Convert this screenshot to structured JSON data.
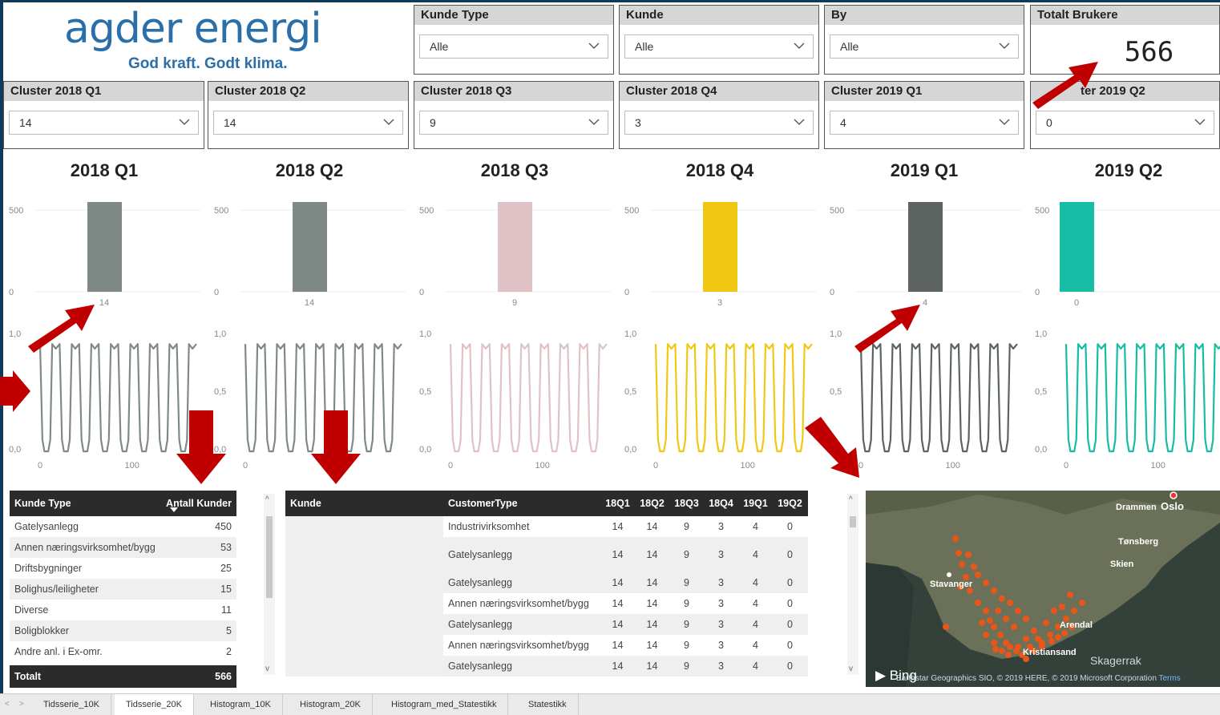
{
  "logo": {
    "brand": "agder energi",
    "tagline": "God kraft. Godt klima."
  },
  "filters": [
    {
      "label": "Kunde Type",
      "value": "Alle"
    },
    {
      "label": "Kunde",
      "value": "Alle"
    },
    {
      "label": "By",
      "value": "Alle"
    }
  ],
  "kpi": {
    "label": "Totalt Brukere",
    "value": "566"
  },
  "cluster_slicers": [
    {
      "label": "Cluster 2018 Q1",
      "value": "14"
    },
    {
      "label": "Cluster 2018 Q2",
      "value": "14"
    },
    {
      "label": "Cluster 2018 Q3",
      "value": "9"
    },
    {
      "label": "Cluster 2018 Q4",
      "value": "3"
    },
    {
      "label": "Cluster 2019 Q1",
      "value": "4"
    },
    {
      "label": "ter 2019 Q2",
      "value": "0"
    }
  ],
  "quarters": [
    {
      "title": "2018 Q1",
      "color": "#7f8a87"
    },
    {
      "title": "2018 Q2",
      "color": "#7f8a87"
    },
    {
      "title": "2018 Q3",
      "color": "#e0c2c6"
    },
    {
      "title": "2018 Q4",
      "color": "#f0c814"
    },
    {
      "title": "2019 Q1",
      "color": "#5c6361"
    },
    {
      "title": "2019 Q2",
      "color": "#16bca4"
    }
  ],
  "chart_data": [
    {
      "type": "bar",
      "title": "2018 Q1",
      "categories": [
        "14"
      ],
      "values": [
        550
      ],
      "ylim": [
        0,
        550
      ],
      "yticks": [
        "500",
        "0"
      ]
    },
    {
      "type": "bar",
      "title": "2018 Q2",
      "categories": [
        "14"
      ],
      "values": [
        550
      ],
      "ylim": [
        0,
        550
      ],
      "yticks": [
        "500",
        "0"
      ]
    },
    {
      "type": "bar",
      "title": "2018 Q3",
      "categories": [
        "9"
      ],
      "values": [
        550
      ],
      "ylim": [
        0,
        550
      ],
      "yticks": [
        "500",
        "0"
      ]
    },
    {
      "type": "bar",
      "title": "2018 Q4",
      "categories": [
        "3"
      ],
      "values": [
        550
      ],
      "ylim": [
        0,
        550
      ],
      "yticks": [
        "500",
        "0"
      ]
    },
    {
      "type": "bar",
      "title": "2019 Q1",
      "categories": [
        "4"
      ],
      "values": [
        550
      ],
      "ylim": [
        0,
        550
      ],
      "yticks": [
        "500",
        "0"
      ]
    },
    {
      "type": "bar",
      "title": "2019 Q2",
      "categories": [
        "0"
      ],
      "values": [
        550
      ],
      "ylim": [
        0,
        550
      ],
      "yticks": [
        "500",
        "0"
      ]
    },
    {
      "type": "line",
      "yticks": [
        "1,0",
        "0,5",
        "0,0"
      ],
      "xticks": [
        "0",
        "100"
      ],
      "xlim": [
        0,
        170
      ],
      "ylim": [
        0,
        1
      ],
      "cycles": 8,
      "top_value": 0.95,
      "bottom_value": 0.02
    }
  ],
  "kunde_type_table": {
    "headers": [
      "Kunde Type",
      "Antall Kunder"
    ],
    "rows": [
      [
        "Gatelysanlegg",
        "450"
      ],
      [
        "Annen næringsvirksomhet/bygg",
        "53"
      ],
      [
        "Driftsbygninger",
        "25"
      ],
      [
        "Bolighus/leiligheter",
        "15"
      ],
      [
        "Diverse",
        "11"
      ],
      [
        "Boligblokker",
        "5"
      ],
      [
        "Andre anl. i Ex-omr.",
        "2"
      ]
    ],
    "total": [
      "Totalt",
      "566"
    ]
  },
  "customer_table": {
    "headers": [
      "Kunde",
      "CustomerType",
      "18Q1",
      "18Q2",
      "18Q3",
      "18Q4",
      "19Q1",
      "19Q2"
    ],
    "rows": [
      [
        "Industrivirksomhet",
        "14",
        "14",
        "9",
        "3",
        "4",
        "0"
      ],
      [
        "Gatelysanlegg",
        "14",
        "14",
        "9",
        "3",
        "4",
        "0"
      ],
      [
        "",
        "",
        "",
        "",
        "",
        "",
        ""
      ],
      [
        "Gatelysanlegg",
        "14",
        "14",
        "9",
        "3",
        "4",
        "0"
      ],
      [
        "Annen næringsvirksomhet/bygg",
        "14",
        "14",
        "9",
        "3",
        "4",
        "0"
      ],
      [
        "Gatelysanlegg",
        "14",
        "14",
        "9",
        "3",
        "4",
        "0"
      ],
      [
        "Annen næringsvirksomhet/bygg",
        "14",
        "14",
        "9",
        "3",
        "4",
        "0"
      ],
      [
        "Gatelysanlegg",
        "14",
        "14",
        "9",
        "3",
        "4",
        "0"
      ]
    ]
  },
  "map": {
    "cities": [
      "Oslo",
      "Drammen",
      "Tønsberg",
      "Skien",
      "Stavanger",
      "Arendal",
      "Kristiansand"
    ],
    "sea": "Skagerrak",
    "provider": "Bing",
    "attribution": "Earthstar Geographics SIO, © 2019 HERE, © 2019 Microsoft Corporation",
    "terms": "Terms"
  },
  "tabs": [
    "Tidsserie_10K",
    "Tidsserie_20K",
    "Histogram_10K",
    "Histogram_20K",
    "Histogram_med_Statestikk",
    "Statestikk"
  ],
  "active_tab": "Tidsserie_20K",
  "colors": {
    "header_dark": "#2b2b2b",
    "slicer_header": "#d6d6d6",
    "arrow_red": "#c00000",
    "brand_blue": "#2a6fa8",
    "map_dot": "#e8561a"
  }
}
